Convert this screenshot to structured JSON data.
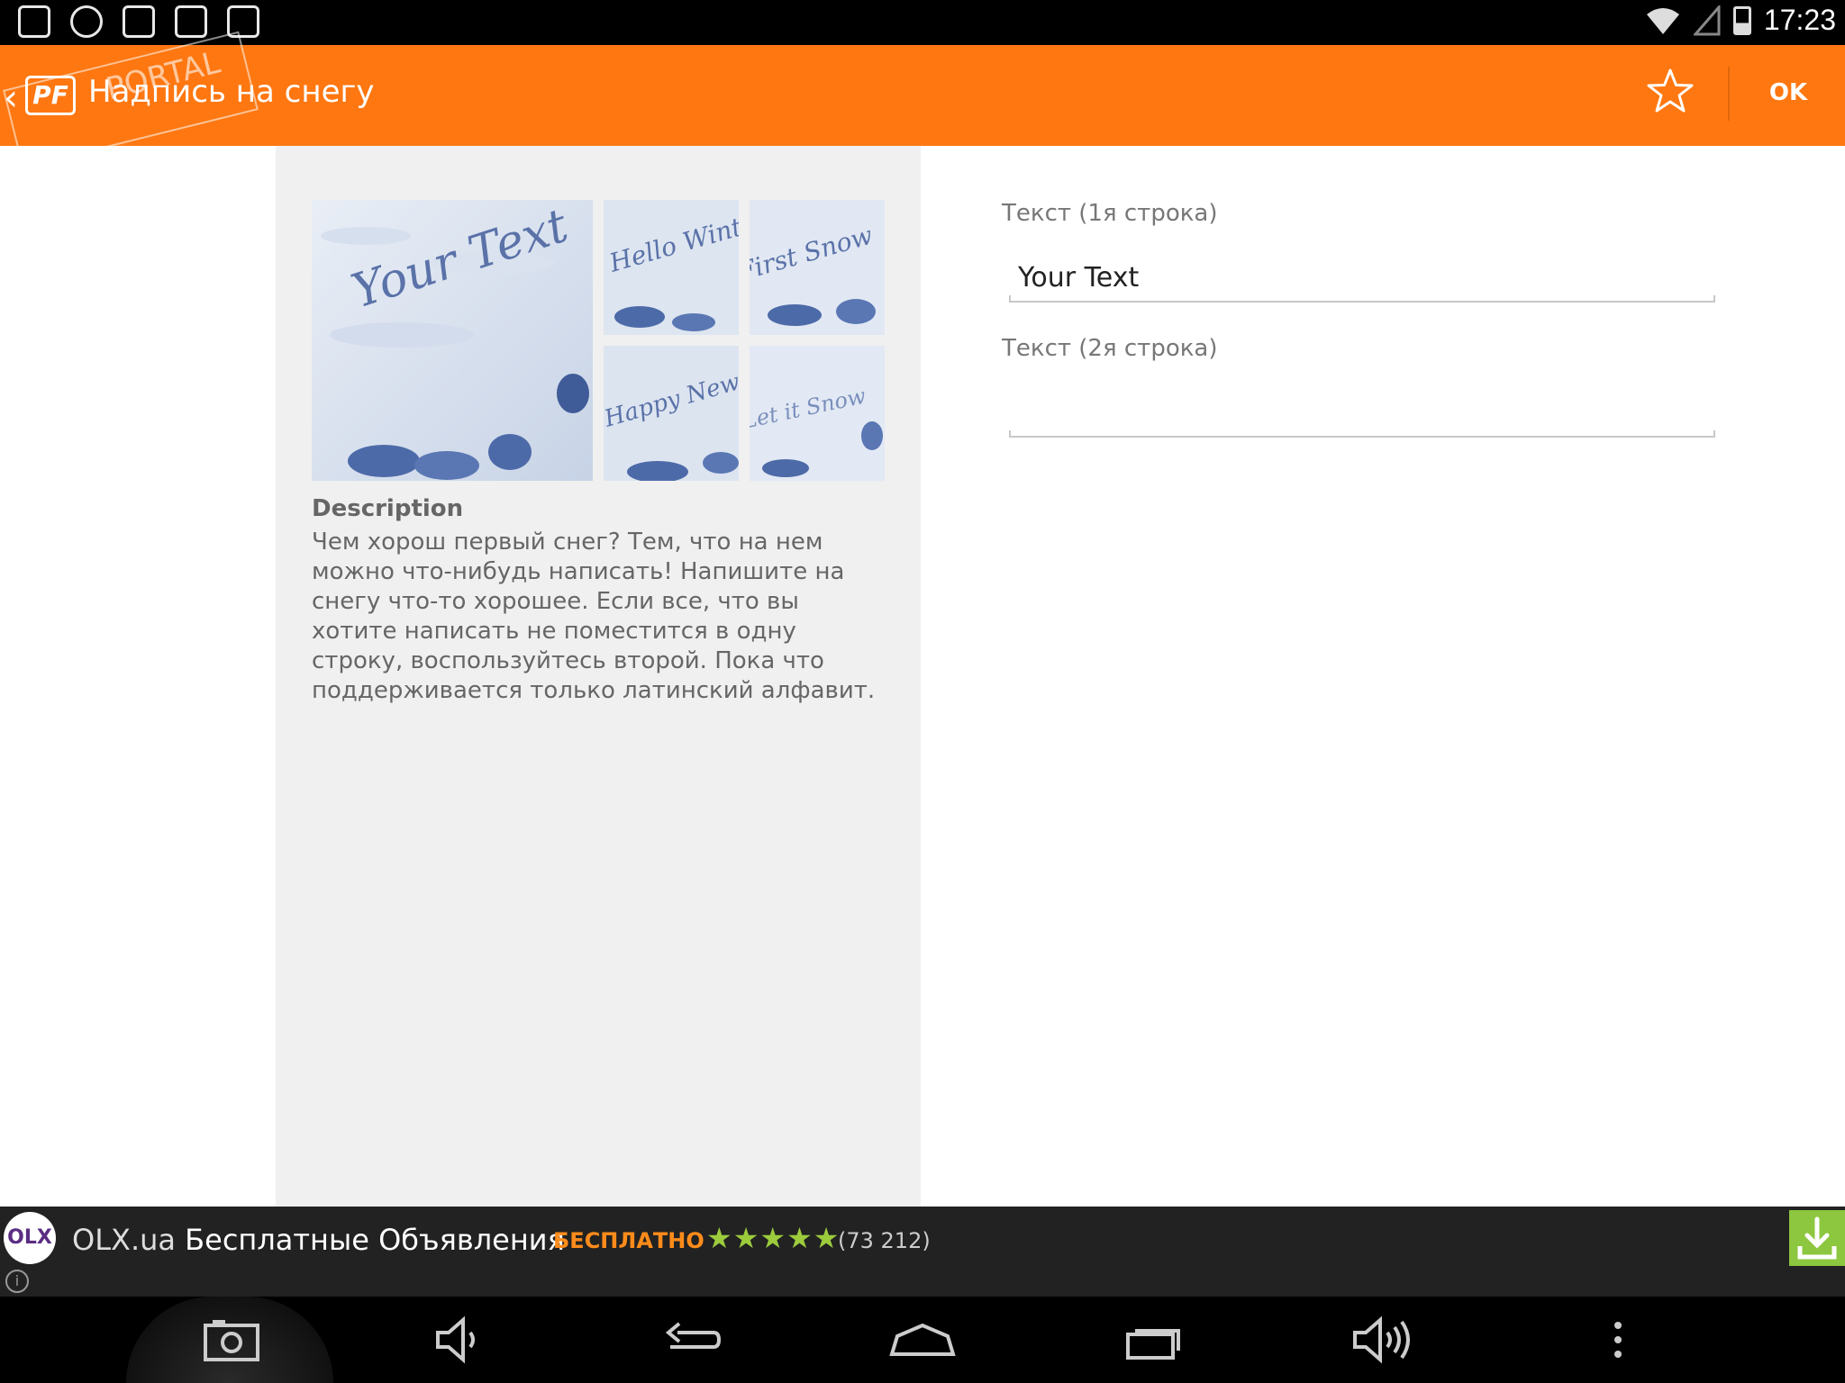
{
  "status_bar": {
    "time": "17:23",
    "left_icons": [
      "gallery-icon",
      "cat-app-icon",
      "messenger-icon",
      "star-app-icon",
      "shopping-bag-icon"
    ],
    "right_icons": [
      "wifi-icon",
      "signal-icon",
      "battery-icon"
    ]
  },
  "action_bar": {
    "title": "Надпись на снегу",
    "logo_text": "PF",
    "watermark_text": "PORTAL",
    "ok_label": "OK",
    "color": "#ff7711"
  },
  "left_panel": {
    "thumbnails": [
      "Your Text",
      "Hello Winter!",
      "First Snow",
      "Happy New Year",
      "Let it Snow"
    ],
    "description_title": "Description",
    "description_text": "Чем хорош первый снег? Тем, что на нем можно что-нибудь написать! Напишите на снегу что-то хорошее. Если все, что вы хотите написать не поместится в одну строку, воспользуйтесь второй. Пока что поддерживается только латинский алфавит."
  },
  "form": {
    "field1_label": "Текст (1я строка)",
    "field1_value": "Your Text",
    "field2_label": "Текст (2я строка)",
    "field2_value": ""
  },
  "ad": {
    "logo_text": "OLX",
    "title_brand": "OLX.ua",
    "title_rest": "Бесплатные Объявления",
    "price": "БЕСПЛАТНО",
    "stars": "★★★★★",
    "rating": 4.5,
    "reviews": "(73 212)",
    "accent": "#8dc63f"
  },
  "nav_bar": {
    "buttons": [
      "screenshot-icon",
      "volume-down-icon",
      "back-icon",
      "home-icon",
      "recent-apps-icon",
      "volume-up-icon",
      "menu-icon"
    ]
  }
}
